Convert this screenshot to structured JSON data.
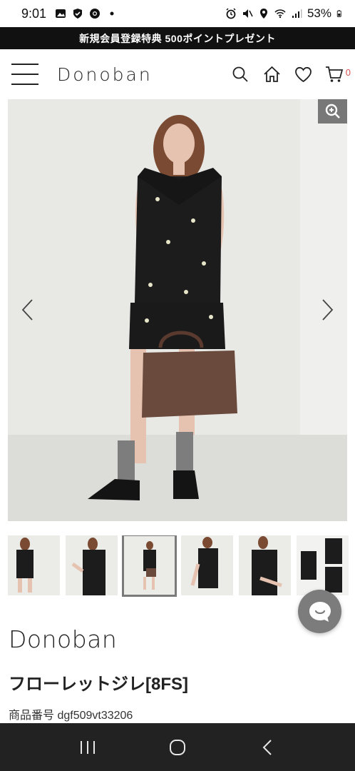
{
  "status_bar": {
    "time": "9:01",
    "battery": "53%"
  },
  "promo_banner": {
    "text": "新規会員登録特典 500ポイントプレゼント"
  },
  "header": {
    "logo": "Donoban",
    "cart_count": "0",
    "icons": [
      "menu-icon",
      "search-icon",
      "home-icon",
      "heart-icon",
      "cart-icon"
    ]
  },
  "gallery": {
    "current_index": 3,
    "thumbnail_count": 6,
    "icons": [
      "zoom-icon",
      "chevron-left-icon",
      "chevron-right-icon"
    ]
  },
  "product": {
    "brand": "Donoban",
    "name": "フローレットジレ[8FS]",
    "code": "商品番号 dgf509vt33206"
  },
  "colors": {
    "promo_bg": "#111111",
    "cart_badge": "#d9534f",
    "nav_bar_bg": "#222222",
    "chat_button": "#7c7c7c"
  }
}
